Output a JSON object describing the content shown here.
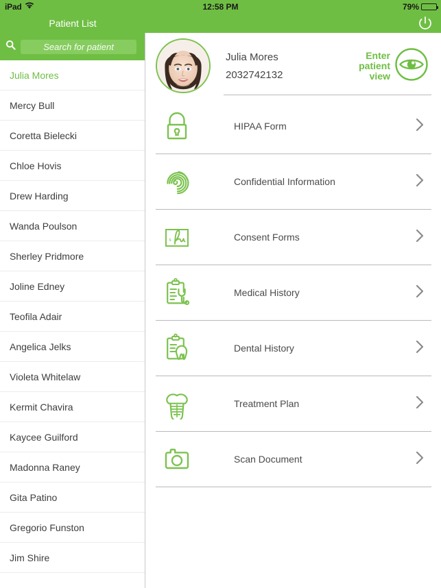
{
  "statusbar": {
    "device": "iPad",
    "wifi_icon": "wifi-icon",
    "time": "12:58 PM",
    "battery_percent": "79%",
    "battery_icon": "battery-icon"
  },
  "topbar": {
    "title": "Patient List",
    "power_icon": "power-icon",
    "background": "#6FBE44"
  },
  "search": {
    "icon": "search-icon",
    "placeholder": "Search for patient",
    "value": ""
  },
  "sidebar": {
    "patients": [
      {
        "name": "Julia Mores",
        "selected": true
      },
      {
        "name": "Mercy Bull",
        "selected": false
      },
      {
        "name": "Coretta Bielecki",
        "selected": false
      },
      {
        "name": "Chloe Hovis",
        "selected": false
      },
      {
        "name": "Drew Harding",
        "selected": false
      },
      {
        "name": "Wanda Poulson",
        "selected": false
      },
      {
        "name": "Sherley Pridmore",
        "selected": false
      },
      {
        "name": "Joline Edney",
        "selected": false
      },
      {
        "name": "Teofila Adair",
        "selected": false
      },
      {
        "name": "Angelica Jelks",
        "selected": false
      },
      {
        "name": "Violeta Whitelaw",
        "selected": false
      },
      {
        "name": "Kermit Chavira",
        "selected": false
      },
      {
        "name": "Kaycee Guilford",
        "selected": false
      },
      {
        "name": "Madonna Raney",
        "selected": false
      },
      {
        "name": "Gita Patino",
        "selected": false
      },
      {
        "name": "Gregorio Funston",
        "selected": false
      },
      {
        "name": "Jim Shire",
        "selected": false
      }
    ]
  },
  "patient": {
    "avatar": "patient-photo",
    "name": "Julia Mores",
    "id": "2032742132",
    "enter_view_label": "Enter\npatient\nview",
    "enter_view_icon": "eye-icon"
  },
  "menu": {
    "items": [
      {
        "label": "HIPAA Form",
        "icon": "lock-icon"
      },
      {
        "label": "Confidential Information",
        "icon": "fingerprint-icon"
      },
      {
        "label": "Consent Forms",
        "icon": "signature-icon"
      },
      {
        "label": "Medical History",
        "icon": "clipboard-stethoscope-icon"
      },
      {
        "label": "Dental History",
        "icon": "clipboard-tooth-icon"
      },
      {
        "label": "Treatment Plan",
        "icon": "dental-implant-icon"
      },
      {
        "label": "Scan Document",
        "icon": "camera-icon"
      }
    ],
    "chevron_icon": "chevron-right-icon"
  },
  "colors": {
    "brand_green": "#6FBE44",
    "icon_green": "#7CC24F",
    "search_field_green": "#86CC5F",
    "text_dark": "#3d3d3d",
    "divider": "#b9b9b9"
  }
}
